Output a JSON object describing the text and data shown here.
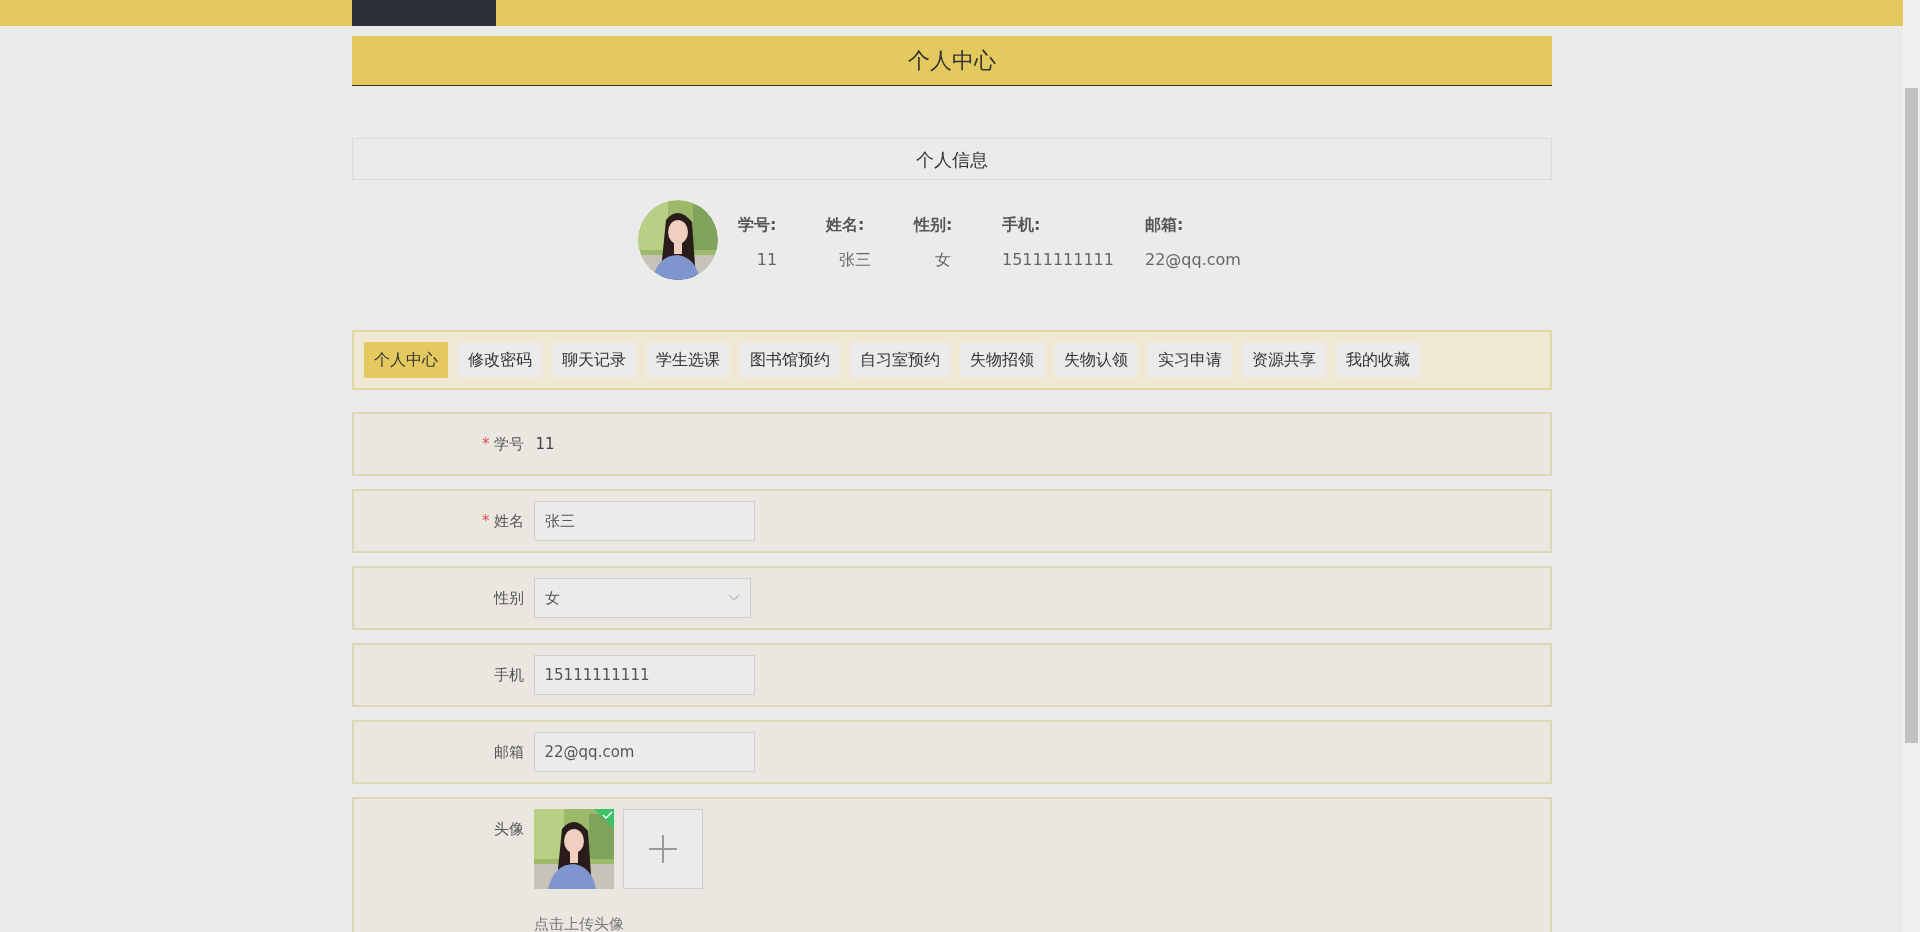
{
  "header": {
    "title": "个人中心"
  },
  "profile": {
    "title": "个人信息",
    "fields": [
      {
        "label": "学号:",
        "value": "11"
      },
      {
        "label": "姓名:",
        "value": "张三"
      },
      {
        "label": "性别:",
        "value": "女"
      },
      {
        "label": "手机:",
        "value": "15111111111"
      },
      {
        "label": "邮箱:",
        "value": "22@qq.com"
      }
    ]
  },
  "tabs": [
    {
      "label": "个人中心",
      "selected": true
    },
    {
      "label": "修改密码",
      "selected": false
    },
    {
      "label": "聊天记录",
      "selected": false
    },
    {
      "label": "学生选课",
      "selected": false
    },
    {
      "label": "图书馆预约",
      "selected": false
    },
    {
      "label": "自习室预约",
      "selected": false
    },
    {
      "label": "失物招领",
      "selected": false
    },
    {
      "label": "失物认领",
      "selected": false
    },
    {
      "label": "实习申请",
      "selected": false
    },
    {
      "label": "资源共享",
      "selected": false
    },
    {
      "label": "我的收藏",
      "selected": false
    }
  ],
  "form": [
    {
      "kind": "text",
      "label": "学号",
      "required_mark": "*",
      "value": "11"
    },
    {
      "kind": "input",
      "label": "姓名",
      "required_mark": "*",
      "value": "张三"
    },
    {
      "kind": "select",
      "label": "性别",
      "value": "女"
    },
    {
      "kind": "input",
      "label": "手机",
      "value": "15111111111"
    },
    {
      "kind": "input",
      "label": "邮箱",
      "value": "22@qq.com"
    },
    {
      "kind": "upload",
      "label": "头像",
      "uploaded": true,
      "hint": "点击上传头像"
    }
  ]
}
